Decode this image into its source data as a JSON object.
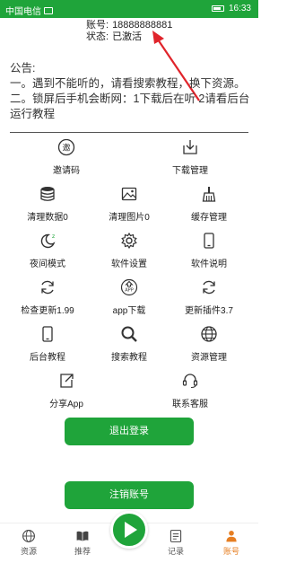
{
  "status_bar": {
    "carrier": "中国电信",
    "time": "16:33"
  },
  "account": {
    "account_label": "账号:",
    "account_value": "18888888881",
    "status_label": "状态:",
    "status_value": "已激活"
  },
  "notice": {
    "title": "公告:",
    "line1": "一。遇到不能听的，请看搜索教程，换下资源。",
    "line2": "二。锁屏后手机会断网：1下载后在听 2请看后台运行教程"
  },
  "menu": [
    {
      "label": "邀请码",
      "icon": "invite-icon"
    },
    {
      "label": "下载管理",
      "icon": "download-icon"
    },
    {
      "label": "清理数据0",
      "icon": "database-icon"
    },
    {
      "label": "清理图片0",
      "icon": "image-icon"
    },
    {
      "label": "缓存管理",
      "icon": "broom-icon"
    },
    {
      "label": "夜间模式",
      "icon": "moon-icon"
    },
    {
      "label": "软件设置",
      "icon": "gear-icon"
    },
    {
      "label": "软件说明",
      "icon": "phone-icon"
    },
    {
      "label": "检查更新1.99",
      "icon": "refresh-icon"
    },
    {
      "label": "app下载",
      "icon": "app-download-icon"
    },
    {
      "label": "更新插件3.7",
      "icon": "refresh-plugin-icon"
    },
    {
      "label": "后台教程",
      "icon": "tablet-icon"
    },
    {
      "label": "搜索教程",
      "icon": "search-icon"
    },
    {
      "label": "资源管理",
      "icon": "globe-icon"
    },
    {
      "label": "分享App",
      "icon": "share-icon"
    },
    {
      "label": "联系客服",
      "icon": "headset-icon"
    }
  ],
  "buttons": {
    "logout": "退出登录",
    "cancel_account": "注销账号"
  },
  "bottom_nav": [
    {
      "label": "资源",
      "icon": "globe-icon"
    },
    {
      "label": "推荐",
      "icon": "book-icon"
    },
    {
      "label": "记录",
      "icon": "record-icon"
    },
    {
      "label": "账号",
      "icon": "user-icon"
    }
  ],
  "colors": {
    "accent": "#1fa43a",
    "active_tab": "#e67e22",
    "arrow": "#e0242b"
  }
}
